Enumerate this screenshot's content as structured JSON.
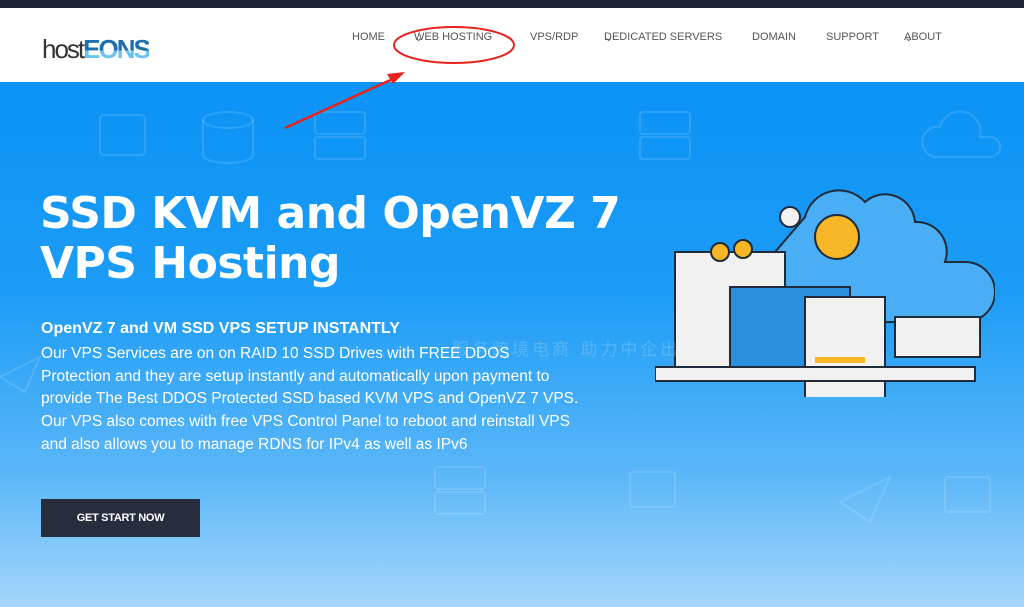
{
  "logo": {
    "part1": "host",
    "part2": "EONS"
  },
  "nav": {
    "items": [
      {
        "label": "HOME",
        "dropdown": false
      },
      {
        "label": "WEB HOSTING",
        "dropdown": true
      },
      {
        "label": "VPS/RDP",
        "dropdown": false
      },
      {
        "label": "DEDICATED SERVERS",
        "dropdown": true
      },
      {
        "label": "DOMAIN",
        "dropdown": false
      },
      {
        "label": "SUPPORT",
        "dropdown": false
      },
      {
        "label": "ABOUT",
        "dropdown": true
      }
    ],
    "chevron": "⌄"
  },
  "hero": {
    "title": "SSD KVM and OpenVZ 7 VPS Hosting",
    "subtitle": "OpenVZ 7 and VM SSD VPS SETUP INSTANTLY",
    "description": "Our VPS Services are on on RAID 10 SSD Drives with FREE DDOS Protection and they are setup instantly and automatically upon payment to provide The Best DDOS Protected SSD based KVM VPS and OpenVZ 7 VPS. Our VPS also comes with free VPS Control Panel to reboot and reinstall VPS and also allows you to manage RDNS for IPv4 as well as IPv6",
    "cta": "GET START NOW"
  },
  "watermark": "服务跨境电商 助力中企出海",
  "colors": {
    "topbar": "#1f2535",
    "hero": "#0b93f6",
    "button": "#272d3d",
    "annotation": "#e8231c"
  }
}
